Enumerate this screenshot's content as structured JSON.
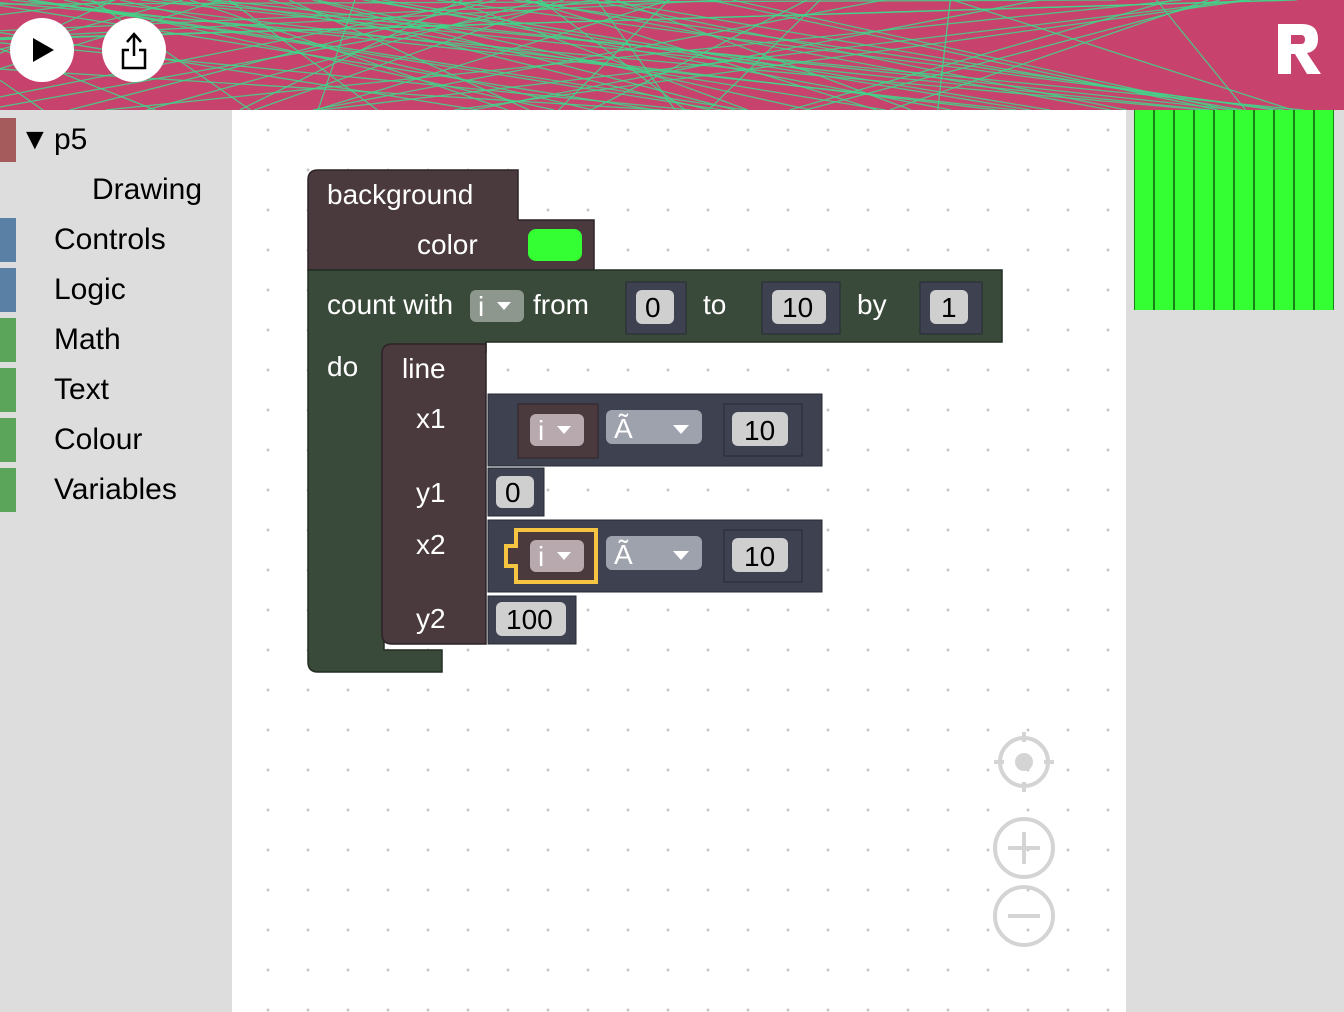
{
  "header": {
    "play_label": "▶",
    "share_label": "share",
    "logo_label": "R"
  },
  "sidebar": {
    "items": [
      {
        "label": "p5",
        "color": "#a55b5b",
        "expanded": true
      },
      {
        "label": "Drawing",
        "color": ""
      },
      {
        "label": "Controls",
        "color": "#5b80a5"
      },
      {
        "label": "Logic",
        "color": "#5b80a5"
      },
      {
        "label": "Math",
        "color": "#5ba55b"
      },
      {
        "label": "Text",
        "color": "#5ba55b"
      },
      {
        "label": "Colour",
        "color": "#5ba55b"
      },
      {
        "label": "Variables",
        "color": "#5ba55b"
      }
    ]
  },
  "blocks": {
    "background": {
      "title": "background",
      "param": "color",
      "color_value": "#33ff33"
    },
    "count": {
      "label": "count with",
      "var": "i",
      "from_label": "from",
      "from_value": "0",
      "to_label": "to",
      "to_value": "10",
      "by_label": "by",
      "by_value": "1",
      "do_label": "do"
    },
    "line": {
      "title": "line",
      "x1_label": "x1",
      "x1_var": "i",
      "x1_op": "Ã",
      "x1_value": "10",
      "y1_label": "y1",
      "y1_value": "0",
      "x2_label": "x2",
      "x2_var": "i",
      "x2_op": "Ã",
      "x2_value": "10",
      "y2_label": "y2",
      "y2_value": "100"
    }
  },
  "preview": {
    "background": "#33ff33",
    "line_color": "#000000",
    "line_count": 11
  },
  "colors": {
    "header_bg": "#c8426e",
    "header_lines": "#3fd88a",
    "p5_block": "#4a3a3e",
    "loop_block": "#3a4a3a",
    "math_block": "#3e4250",
    "selected": "#f5c542"
  }
}
